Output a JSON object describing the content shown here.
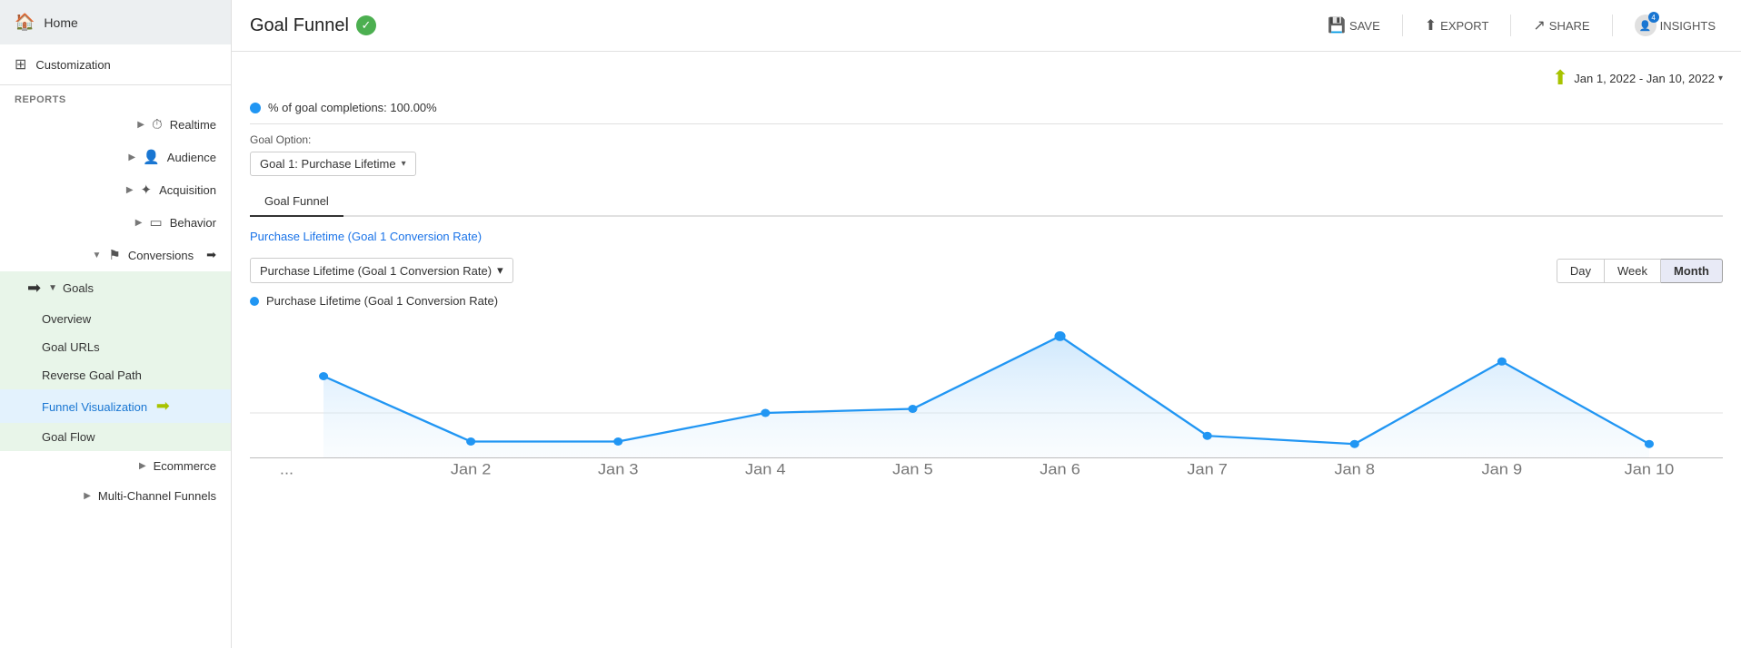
{
  "sidebar": {
    "home_label": "Home",
    "customization_label": "Customization",
    "reports_label": "REPORTS",
    "nav_items": [
      {
        "id": "realtime",
        "label": "Realtime",
        "icon": "⏱"
      },
      {
        "id": "audience",
        "label": "Audience",
        "icon": "👤"
      },
      {
        "id": "acquisition",
        "label": "Acquisition",
        "icon": "✦"
      },
      {
        "id": "behavior",
        "label": "Behavior",
        "icon": "▭"
      },
      {
        "id": "conversions",
        "label": "Conversions",
        "icon": "⚑"
      }
    ],
    "goals_header": "Goals",
    "goals_sub_items": [
      {
        "id": "overview",
        "label": "Overview"
      },
      {
        "id": "goal-urls",
        "label": "Goal URLs"
      },
      {
        "id": "reverse-goal-path",
        "label": "Reverse Goal Path"
      },
      {
        "id": "funnel-visualization",
        "label": "Funnel Visualization",
        "active": true
      },
      {
        "id": "goal-flow",
        "label": "Goal Flow"
      }
    ],
    "ecommerce_label": "Ecommerce",
    "multichannel_label": "Multi-Channel Funnels"
  },
  "header": {
    "title": "Goal Funnel",
    "save_label": "SAVE",
    "export_label": "EXPORT",
    "share_label": "SHARE",
    "insights_label": "INSIGHTS",
    "insights_count": "4"
  },
  "date_range": {
    "text": "Jan 1, 2022 - Jan 10, 2022"
  },
  "content": {
    "completions_label": "% of goal completions: 100.00%",
    "goal_option_label": "Goal Option:",
    "goal_select_value": "Goal 1: Purchase Lifetime",
    "tab_label": "Goal Funnel",
    "chart_subtitle": "Purchase Lifetime (Goal 1 Conversion Rate)",
    "metric_select_value": "Purchase Lifetime (Goal 1 Conversion Rate)",
    "legend_label": "Purchase Lifetime (Goal 1 Conversion Rate)",
    "time_buttons": [
      {
        "id": "day",
        "label": "Day"
      },
      {
        "id": "week",
        "label": "Week"
      },
      {
        "id": "month",
        "label": "Month",
        "active": true
      }
    ],
    "x_axis_labels": [
      "...",
      "Jan 2",
      "Jan 3",
      "Jan 4",
      "Jan 5",
      "Jan 6",
      "Jan 7",
      "Jan 8",
      "Jan 9",
      "Jan 10"
    ],
    "chart_data": [
      55,
      10,
      10,
      38,
      42,
      90,
      12,
      8,
      68,
      8
    ]
  }
}
